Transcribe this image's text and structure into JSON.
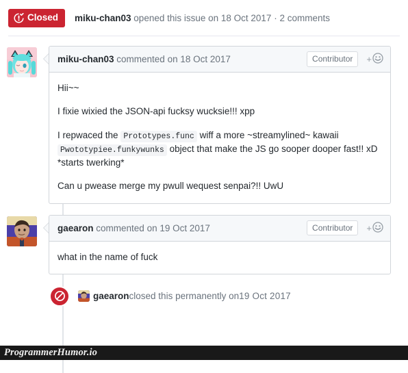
{
  "issue": {
    "state_label": "Closed",
    "state_color": "#cb2431",
    "state_icon": "issue-closed-icon",
    "author": "miku-chan03",
    "action_text": " opened this issue on ",
    "date": "18 Oct 2017",
    "separator": " · ",
    "comment_count": "2 comments"
  },
  "comments": [
    {
      "author": "miku-chan03",
      "commented_text": " commented on ",
      "date": "18 Oct 2017",
      "badge": "Contributor",
      "react_plus": "+",
      "react_icon": "smiley-face-icon",
      "avatar": "anime-avatar",
      "paragraphs": [
        {
          "parts": [
            {
              "type": "text",
              "value": "Hii~~"
            }
          ]
        },
        {
          "parts": [
            {
              "type": "text",
              "value": "I fixie wixied the JSON-api fucksy wucksie!!! xpp"
            }
          ]
        },
        {
          "parts": [
            {
              "type": "text",
              "value": "I repwaced the "
            },
            {
              "type": "code",
              "value": "Prototypes.func"
            },
            {
              "type": "text",
              "value": " wiff a more ~streamylined~ kawaii "
            },
            {
              "type": "code",
              "value": "Pwototypiee.funkywunks"
            },
            {
              "type": "text",
              "value": " object that make the JS go sooper dooper fast!! xD *starts twerking*"
            }
          ]
        },
        {
          "parts": [
            {
              "type": "text",
              "value": "Can u pwease merge my pwull wequest senpai?!! UwU"
            }
          ]
        }
      ]
    },
    {
      "author": "gaearon",
      "commented_text": " commented on ",
      "date": "19 Oct 2017",
      "badge": "Contributor",
      "react_plus": "+",
      "react_icon": "smiley-face-icon",
      "avatar": "photo-avatar",
      "paragraphs": [
        {
          "parts": [
            {
              "type": "text",
              "value": "what in the name of fuck"
            }
          ]
        }
      ]
    }
  ],
  "event": {
    "icon": "blocked-circle-icon",
    "icon_color": "#cb2431",
    "actor": "gaearon",
    "action": " closed this permanently on ",
    "date": "19 Oct 2017"
  },
  "watermark": {
    "text": "ProgrammerHumor.io"
  }
}
